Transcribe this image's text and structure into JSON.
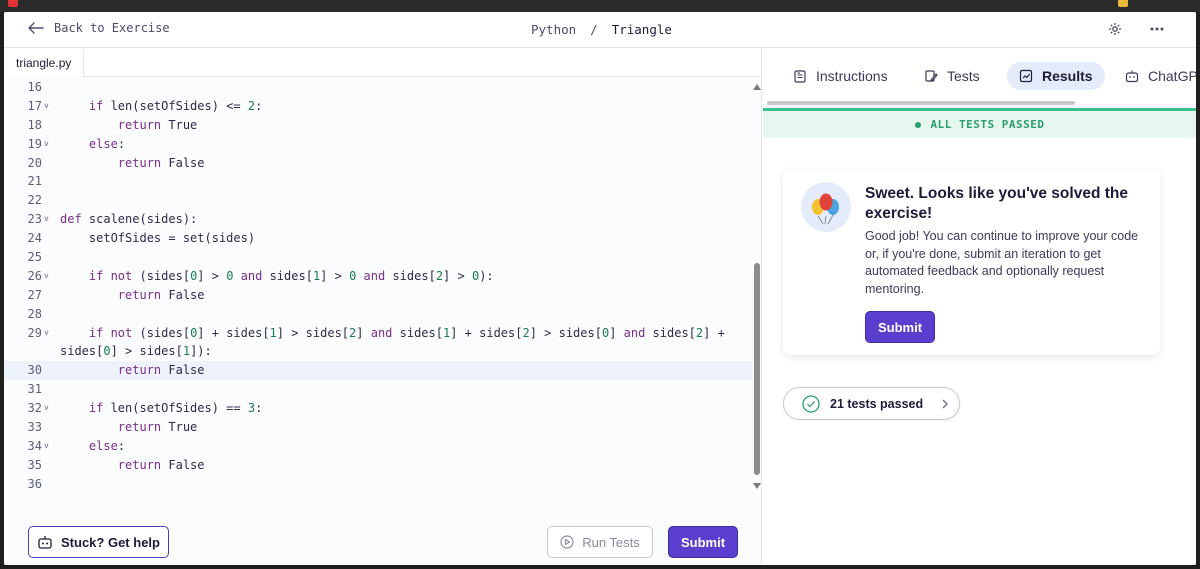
{
  "header": {
    "back_label": "Back to Exercise",
    "crumb_language": "Python",
    "crumb_separator": "/",
    "crumb_exercise": "Triangle"
  },
  "editor": {
    "file_tab": "triangle.py",
    "lines": [
      {
        "n": "16",
        "fold": "",
        "active": false,
        "tokens": []
      },
      {
        "n": "17",
        "fold": "v",
        "active": false,
        "tokens": [
          [
            "",
            "    "
          ],
          [
            "kw",
            "if"
          ],
          [
            "",
            " len(setOfSides) <= "
          ],
          [
            "num",
            "2"
          ],
          [
            "",
            ":"
          ]
        ]
      },
      {
        "n": "18",
        "fold": "",
        "active": false,
        "tokens": [
          [
            "",
            "        "
          ],
          [
            "kw",
            "return"
          ],
          [
            "",
            " True"
          ]
        ]
      },
      {
        "n": "19",
        "fold": "v",
        "active": false,
        "tokens": [
          [
            "",
            "    "
          ],
          [
            "kw",
            "else"
          ],
          [
            "",
            ":"
          ]
        ]
      },
      {
        "n": "20",
        "fold": "",
        "active": false,
        "tokens": [
          [
            "",
            "        "
          ],
          [
            "kw",
            "return"
          ],
          [
            "",
            " False"
          ]
        ]
      },
      {
        "n": "21",
        "fold": "",
        "active": false,
        "tokens": []
      },
      {
        "n": "22",
        "fold": "",
        "active": false,
        "tokens": []
      },
      {
        "n": "23",
        "fold": "v",
        "active": false,
        "tokens": [
          [
            "kw",
            "def"
          ],
          [
            "",
            " scalene(sides):"
          ]
        ]
      },
      {
        "n": "24",
        "fold": "",
        "active": false,
        "tokens": [
          [
            "",
            "    setOfSides = set(sides)"
          ]
        ]
      },
      {
        "n": "25",
        "fold": "",
        "active": false,
        "tokens": []
      },
      {
        "n": "26",
        "fold": "v",
        "active": false,
        "tokens": [
          [
            "",
            "    "
          ],
          [
            "kw",
            "if not"
          ],
          [
            "",
            " (sides["
          ],
          [
            "num",
            "0"
          ],
          [
            "",
            "] > "
          ],
          [
            "num",
            "0"
          ],
          [
            "",
            " "
          ],
          [
            "kw",
            "and"
          ],
          [
            "",
            " sides["
          ],
          [
            "num",
            "1"
          ],
          [
            "",
            "] > "
          ],
          [
            "num",
            "0"
          ],
          [
            "",
            " "
          ],
          [
            "kw",
            "and"
          ],
          [
            "",
            " sides["
          ],
          [
            "num",
            "2"
          ],
          [
            "",
            "] > "
          ],
          [
            "num",
            "0"
          ],
          [
            "",
            "):"
          ]
        ]
      },
      {
        "n": "27",
        "fold": "",
        "active": false,
        "tokens": [
          [
            "",
            "        "
          ],
          [
            "kw",
            "return"
          ],
          [
            "",
            " False"
          ]
        ]
      },
      {
        "n": "28",
        "fold": "",
        "active": false,
        "tokens": []
      },
      {
        "n": "29",
        "fold": "v",
        "active": false,
        "tokens": [
          [
            "",
            "    "
          ],
          [
            "kw",
            "if not"
          ],
          [
            "",
            " (sides["
          ],
          [
            "num",
            "0"
          ],
          [
            "",
            "] + sides["
          ],
          [
            "num",
            "1"
          ],
          [
            "",
            "] > sides["
          ],
          [
            "num",
            "2"
          ],
          [
            "",
            "] "
          ],
          [
            "kw",
            "and"
          ],
          [
            "",
            " sides["
          ],
          [
            "num",
            "1"
          ],
          [
            "",
            "] + sides["
          ],
          [
            "num",
            "2"
          ],
          [
            "",
            "] > sides["
          ],
          [
            "num",
            "0"
          ],
          [
            "",
            "] "
          ],
          [
            "kw",
            "and"
          ],
          [
            "",
            " sides["
          ],
          [
            "num",
            "2"
          ],
          [
            "",
            "] +"
          ]
        ]
      },
      {
        "n": "",
        "fold": "",
        "active": false,
        "tokens": [
          [
            "",
            "sides["
          ],
          [
            "num",
            "0"
          ],
          [
            "",
            "] > sides["
          ],
          [
            "num",
            "1"
          ],
          [
            "",
            "]):"
          ]
        ]
      },
      {
        "n": "30",
        "fold": "",
        "active": true,
        "tokens": [
          [
            "",
            "        "
          ],
          [
            "kw",
            "return"
          ],
          [
            "",
            " False"
          ]
        ]
      },
      {
        "n": "31",
        "fold": "",
        "active": false,
        "tokens": []
      },
      {
        "n": "32",
        "fold": "v",
        "active": false,
        "tokens": [
          [
            "",
            "    "
          ],
          [
            "kw",
            "if"
          ],
          [
            "",
            " len(setOfSides) == "
          ],
          [
            "num",
            "3"
          ],
          [
            "",
            ":"
          ]
        ]
      },
      {
        "n": "33",
        "fold": "",
        "active": false,
        "tokens": [
          [
            "",
            "        "
          ],
          [
            "kw",
            "return"
          ],
          [
            "",
            " True"
          ]
        ]
      },
      {
        "n": "34",
        "fold": "v",
        "active": false,
        "tokens": [
          [
            "",
            "    "
          ],
          [
            "kw",
            "else"
          ],
          [
            "",
            ":"
          ]
        ]
      },
      {
        "n": "35",
        "fold": "",
        "active": false,
        "tokens": [
          [
            "",
            "        "
          ],
          [
            "kw",
            "return"
          ],
          [
            "",
            " False"
          ]
        ]
      },
      {
        "n": "36",
        "fold": "",
        "active": false,
        "tokens": []
      }
    ],
    "help_label": "Stuck? Get help",
    "run_tests_label": "Run Tests",
    "submit_label": "Submit"
  },
  "panel": {
    "tabs": [
      {
        "label": "Instructions",
        "icon": "clipboard-icon",
        "active": false
      },
      {
        "label": "Tests",
        "icon": "pencil-note-icon",
        "active": false
      },
      {
        "label": "Results",
        "icon": "chart-check-icon",
        "active": true
      },
      {
        "label": "ChatGP",
        "icon": "robot-icon",
        "active": false
      }
    ],
    "status": "ALL TESTS PASSED",
    "card": {
      "title": "Sweet. Looks like you've solved the exercise!",
      "body": "Good job! You can continue to improve your code or, if you're done, submit an iteration to get automated feedback and optionally request mentoring.",
      "submit_label": "Submit",
      "icon": "balloons-icon"
    },
    "tests_passed": "21 tests passed"
  },
  "colors": {
    "accent": "#5a3fcf",
    "success": "#2a9d6f",
    "keyword": "#7a2d8a",
    "number": "#1b7a55"
  }
}
